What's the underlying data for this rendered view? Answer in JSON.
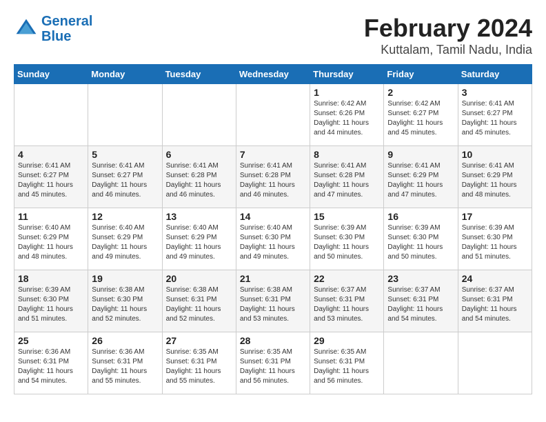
{
  "logo": {
    "line1": "General",
    "line2": "Blue"
  },
  "title": "February 2024",
  "subtitle": "Kuttalam, Tamil Nadu, India",
  "header_days": [
    "Sunday",
    "Monday",
    "Tuesday",
    "Wednesday",
    "Thursday",
    "Friday",
    "Saturday"
  ],
  "weeks": [
    [
      {
        "day": "",
        "info": ""
      },
      {
        "day": "",
        "info": ""
      },
      {
        "day": "",
        "info": ""
      },
      {
        "day": "",
        "info": ""
      },
      {
        "day": "1",
        "info": "Sunrise: 6:42 AM\nSunset: 6:26 PM\nDaylight: 11 hours\nand 44 minutes."
      },
      {
        "day": "2",
        "info": "Sunrise: 6:42 AM\nSunset: 6:27 PM\nDaylight: 11 hours\nand 45 minutes."
      },
      {
        "day": "3",
        "info": "Sunrise: 6:41 AM\nSunset: 6:27 PM\nDaylight: 11 hours\nand 45 minutes."
      }
    ],
    [
      {
        "day": "4",
        "info": "Sunrise: 6:41 AM\nSunset: 6:27 PM\nDaylight: 11 hours\nand 45 minutes."
      },
      {
        "day": "5",
        "info": "Sunrise: 6:41 AM\nSunset: 6:27 PM\nDaylight: 11 hours\nand 46 minutes."
      },
      {
        "day": "6",
        "info": "Sunrise: 6:41 AM\nSunset: 6:28 PM\nDaylight: 11 hours\nand 46 minutes."
      },
      {
        "day": "7",
        "info": "Sunrise: 6:41 AM\nSunset: 6:28 PM\nDaylight: 11 hours\nand 46 minutes."
      },
      {
        "day": "8",
        "info": "Sunrise: 6:41 AM\nSunset: 6:28 PM\nDaylight: 11 hours\nand 47 minutes."
      },
      {
        "day": "9",
        "info": "Sunrise: 6:41 AM\nSunset: 6:29 PM\nDaylight: 11 hours\nand 47 minutes."
      },
      {
        "day": "10",
        "info": "Sunrise: 6:41 AM\nSunset: 6:29 PM\nDaylight: 11 hours\nand 48 minutes."
      }
    ],
    [
      {
        "day": "11",
        "info": "Sunrise: 6:40 AM\nSunset: 6:29 PM\nDaylight: 11 hours\nand 48 minutes."
      },
      {
        "day": "12",
        "info": "Sunrise: 6:40 AM\nSunset: 6:29 PM\nDaylight: 11 hours\nand 49 minutes."
      },
      {
        "day": "13",
        "info": "Sunrise: 6:40 AM\nSunset: 6:29 PM\nDaylight: 11 hours\nand 49 minutes."
      },
      {
        "day": "14",
        "info": "Sunrise: 6:40 AM\nSunset: 6:30 PM\nDaylight: 11 hours\nand 49 minutes."
      },
      {
        "day": "15",
        "info": "Sunrise: 6:39 AM\nSunset: 6:30 PM\nDaylight: 11 hours\nand 50 minutes."
      },
      {
        "day": "16",
        "info": "Sunrise: 6:39 AM\nSunset: 6:30 PM\nDaylight: 11 hours\nand 50 minutes."
      },
      {
        "day": "17",
        "info": "Sunrise: 6:39 AM\nSunset: 6:30 PM\nDaylight: 11 hours\nand 51 minutes."
      }
    ],
    [
      {
        "day": "18",
        "info": "Sunrise: 6:39 AM\nSunset: 6:30 PM\nDaylight: 11 hours\nand 51 minutes."
      },
      {
        "day": "19",
        "info": "Sunrise: 6:38 AM\nSunset: 6:30 PM\nDaylight: 11 hours\nand 52 minutes."
      },
      {
        "day": "20",
        "info": "Sunrise: 6:38 AM\nSunset: 6:31 PM\nDaylight: 11 hours\nand 52 minutes."
      },
      {
        "day": "21",
        "info": "Sunrise: 6:38 AM\nSunset: 6:31 PM\nDaylight: 11 hours\nand 53 minutes."
      },
      {
        "day": "22",
        "info": "Sunrise: 6:37 AM\nSunset: 6:31 PM\nDaylight: 11 hours\nand 53 minutes."
      },
      {
        "day": "23",
        "info": "Sunrise: 6:37 AM\nSunset: 6:31 PM\nDaylight: 11 hours\nand 54 minutes."
      },
      {
        "day": "24",
        "info": "Sunrise: 6:37 AM\nSunset: 6:31 PM\nDaylight: 11 hours\nand 54 minutes."
      }
    ],
    [
      {
        "day": "25",
        "info": "Sunrise: 6:36 AM\nSunset: 6:31 PM\nDaylight: 11 hours\nand 54 minutes."
      },
      {
        "day": "26",
        "info": "Sunrise: 6:36 AM\nSunset: 6:31 PM\nDaylight: 11 hours\nand 55 minutes."
      },
      {
        "day": "27",
        "info": "Sunrise: 6:35 AM\nSunset: 6:31 PM\nDaylight: 11 hours\nand 55 minutes."
      },
      {
        "day": "28",
        "info": "Sunrise: 6:35 AM\nSunset: 6:31 PM\nDaylight: 11 hours\nand 56 minutes."
      },
      {
        "day": "29",
        "info": "Sunrise: 6:35 AM\nSunset: 6:31 PM\nDaylight: 11 hours\nand 56 minutes."
      },
      {
        "day": "",
        "info": ""
      },
      {
        "day": "",
        "info": ""
      }
    ]
  ]
}
